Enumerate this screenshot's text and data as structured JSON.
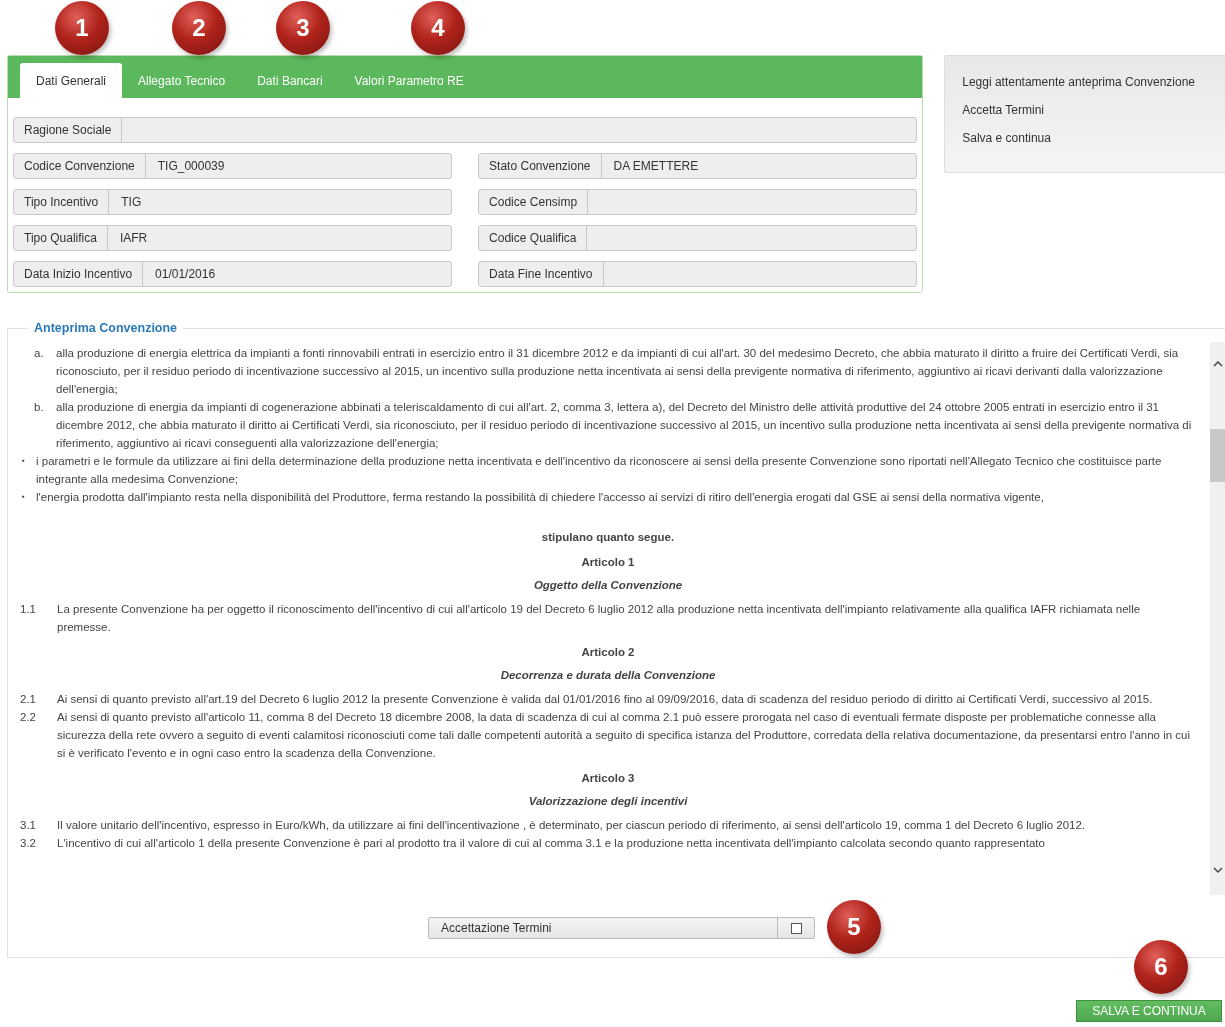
{
  "tabs": [
    {
      "label": "Dati Generali",
      "selected": true
    },
    {
      "label": "Allegato Tecnico",
      "selected": false
    },
    {
      "label": "Dati Bancari",
      "selected": false
    },
    {
      "label": "Valori Parametro RE",
      "selected": false
    }
  ],
  "fields": [
    [
      {
        "label": "Ragione Sociale"
      }
    ],
    [
      {
        "label": "Codice Convenzione",
        "value": "TIG_000039"
      },
      {
        "label": "Stato Convenzione",
        "value": "DA EMETTERE"
      }
    ],
    [
      {
        "label": "Tipo Incentivo",
        "value": "TIG"
      },
      {
        "label": "Codice Censimp"
      }
    ],
    [
      {
        "label": "Tipo Qualifica",
        "value": "IAFR"
      },
      {
        "label": "Codice Qualifica"
      }
    ],
    [
      {
        "label": "Data Inizio Incentivo",
        "value": "01/01/2016"
      },
      {
        "label": "Data Fine Incentivo"
      }
    ]
  ],
  "steps": [
    "Leggi attentamente anteprima Convenzione",
    "Accetta Termini",
    "Salva e continua"
  ],
  "preview": {
    "title": "Anteprima Convenzione",
    "blocks": [
      {
        "kind": "item",
        "marker": "a.",
        "text": "alla produzione di energia elettrica da impianti a fonti rinnovabili entrati in esercizio entro il 31 dicembre 2012 e da impianti di cui all'art. 30 del medesimo Decreto, che abbia maturato il diritto a fruire dei Certificati Verdi, sia riconosciuto, per il residuo periodo di incentivazione successivo al 2015, un incentivo sulla produzione netta incentivata ai sensi della previgente normativa di riferimento, aggiuntivo ai ricavi derivanti dalla valorizzazione dell'energia;"
      },
      {
        "kind": "item",
        "marker": "b.",
        "text": "alla produzione di energia da impianti di cogenerazione abbinati a teleriscaldamento di cui all'art. 2, comma 3, lettera a), del Decreto del Ministro delle attività produttive del 24 ottobre 2005 entrati in esercizio entro il 31 dicembre 2012, che abbia maturato il diritto ai Certificati Verdi, sia riconosciuto, per il residuo periodo di incentivazione successivo al 2015, un incentivo sulla produzione netta incentivata ai sensi della previgente normativa di riferimento, aggiuntivo ai ricavi conseguenti alla valorizzazione dell'energia;"
      },
      {
        "kind": "bullet",
        "marker": "▪",
        "text": "i parametri e le formule da utilizzare ai fini della determinazione della produzione netta incentivata e dell'incentivo da riconoscere ai sensi della presente Convenzione sono riportati nell'Allegato Tecnico che costituisce parte integrante alla medesima Convenzione;"
      },
      {
        "kind": "bullet",
        "marker": "▪",
        "text": "l'energia prodotta dall'impianto resta nella disponibilità del Produttore, ferma restando la possibilità di chiedere l'accesso ai servizi di ritiro dell'energia erogati dal GSE ai sensi della normativa vigente,"
      },
      {
        "kind": "heading",
        "text": "stipulano quanto segue."
      },
      {
        "kind": "heading",
        "text": "Articolo 1"
      },
      {
        "kind": "subheading",
        "text": "Oggetto della Convenzione"
      },
      {
        "kind": "clause",
        "marker": "1.1",
        "text": "La presente Convenzione ha per oggetto il riconoscimento dell'incentivo di cui all'articolo 19 del Decreto 6 luglio 2012 alla produzione netta incentivata dell'impianto relativamente alla qualifica IAFR richiamata nelle premesse."
      },
      {
        "kind": "heading",
        "text": "Articolo 2"
      },
      {
        "kind": "subheading",
        "text": "Decorrenza e durata della Convenzione"
      },
      {
        "kind": "clause",
        "marker": "2.1",
        "text": "Ai sensi di quanto previsto all'art.19 del Decreto 6 luglio 2012 la presente Convenzione è valida dal 01/01/2016 fino al 09/09/2016, data di scadenza del residuo periodo di diritto ai Certificati Verdi, successivo al 2015."
      },
      {
        "kind": "clause",
        "marker": "2.2",
        "text": "Ai sensi di quanto previsto all'articolo 11, comma 8 del Decreto 18 dicembre 2008, la data di scadenza di cui al comma 2.1 può essere prorogata nel caso di eventuali fermate disposte per problematiche connesse alla sicurezza della rete ovvero a seguito di eventi calamitosi riconosciuti come tali dalle competenti autorità a seguito di specifica istanza del Produttore, corredata della relativa documentazione, da presentarsi entro l'anno in cui si è verificato l'evento e in ogni caso entro la scadenza della Convenzione."
      },
      {
        "kind": "heading",
        "text": "Articolo 3"
      },
      {
        "kind": "subheading",
        "text": "Valorizzazione degli incentivi"
      },
      {
        "kind": "clause",
        "marker": "3.1",
        "text": "Il valore unitario dell'incentivo, espresso in Euro/kWh, da utilizzare ai fini dell'incentivazione , è determinato, per ciascun periodo di riferimento, ai sensi dell'articolo 19, comma 1 del Decreto 6 luglio 2012."
      },
      {
        "kind": "clause",
        "marker": "3.2",
        "text": "L'incentivo di cui all'articolo 1 della presente Convenzione è pari al prodotto tra il valore di cui al comma 3.1 e la produzione netta incentivata dell'impianto calcolata secondo quanto rappresentato"
      }
    ]
  },
  "acceptance": {
    "label": "Accettazione Termini",
    "checked": false
  },
  "save_button": "SALVA E CONTINUA",
  "callouts": [
    "1",
    "2",
    "3",
    "4",
    "5",
    "6"
  ]
}
